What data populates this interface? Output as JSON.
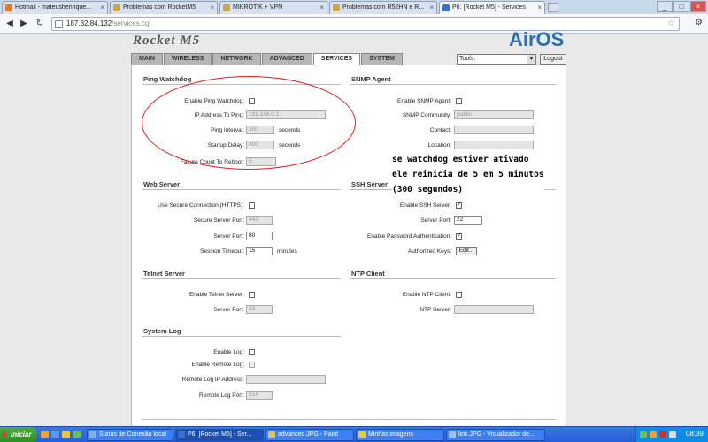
{
  "browser": {
    "tabs": [
      {
        "label": "Hotmail - mateushenrique...",
        "icon_color": "#e8762b",
        "active": false
      },
      {
        "label": "Problemas com RocketM5",
        "icon_color": "#c9a84d",
        "active": false
      },
      {
        "label": "MIKROTIK + VPN",
        "icon_color": "#c9a84d",
        "active": false
      },
      {
        "label": "Problemas com R52HN e R...",
        "icon_color": "#c9a84d",
        "active": false
      },
      {
        "label": "P6: [Rocket M5] - Services",
        "icon_color": "#3a74c9",
        "active": true
      }
    ],
    "close_glyph": "×",
    "url_host": "187.32.84.132",
    "url_path": "/services.cgi",
    "window_buttons": [
      "_",
      "□",
      "×"
    ]
  },
  "header": {
    "logo_text": "Rocket M5",
    "brand_text": "AirOS",
    "nav_tabs": [
      "MAIN",
      "WIRELESS",
      "NETWORK",
      "ADVANCED",
      "SERVICES",
      "SYSTEM"
    ],
    "active_tab": "SERVICES",
    "tools_label": "Tools:",
    "logout_label": "Logout"
  },
  "ping_watchdog": {
    "title": "Ping Watchdog",
    "enable_label": "Enable Ping Watchdog:",
    "ip_label": "IP Address To Ping:",
    "ip_value": "192.168.0.1",
    "interval_label": "Ping Interval:",
    "interval_value": "300",
    "interval_unit": "seconds",
    "delay_label": "Startup Delay:",
    "delay_value": "300",
    "delay_unit": "seconds",
    "failure_label": "Failure Count To Reboot:",
    "failure_value": "5"
  },
  "snmp_agent": {
    "title": "SNMP Agent",
    "enable_label": "Enable SNMP Agent:",
    "community_label": "SNMP Community:",
    "community_value": "public",
    "contact_label": "Contact:",
    "location_label": "Location:"
  },
  "web_server": {
    "title": "Web Server",
    "https_label": "Use Secure Connection (HTTPS):",
    "secure_port_label": "Secure Server Port:",
    "secure_port_value": "443",
    "port_label": "Server Port:",
    "port_value": "80",
    "timeout_label": "Session Timeout:",
    "timeout_value": "15",
    "timeout_unit": "minutes"
  },
  "ssh_server": {
    "title": "SSH Server",
    "enable_label": "Enable SSH Server:",
    "enable_checked": true,
    "port_label": "Server Port:",
    "port_value": "22",
    "password_label": "Enable Password Authentication:",
    "password_checked": true,
    "keys_label": "Authorized Keys:",
    "edit_label": "Edit..."
  },
  "telnet_server": {
    "title": "Telnet Server",
    "enable_label": "Enable Telnet Server:",
    "port_label": "Server Port:",
    "port_value": "23"
  },
  "ntp_client": {
    "title": "NTP Client",
    "enable_label": "Enable NTP Client:",
    "server_label": "NTP Server:"
  },
  "system_log": {
    "title": "System Log",
    "enable_label": "Enable Log:",
    "remote_label": "Enable Remote Log:",
    "remote_ip_label": "Remote Log IP Address:",
    "remote_port_label": "Remote Log Port:",
    "remote_port_value": "514"
  },
  "annotation": {
    "lines": [
      "se watchdog estiver ativado",
      "ele reinicia de 5 em 5 minutos",
      "(300 segundos)"
    ],
    "ellipse_color": "#e02020"
  },
  "taskbar": {
    "start_label": "Iniciar",
    "items": [
      {
        "label": "Status de Conexão local",
        "icon_color": "#7fb2e5"
      },
      {
        "label": "P6: [Rocket M5] - Ser...",
        "icon_color": "#3a74c9"
      },
      {
        "label": "advanced.JPG - Paint",
        "icon_color": "#d9c26a"
      },
      {
        "label": "Minhas imagens",
        "icon_color": "#e8c84a"
      },
      {
        "label": "link.JPG - Visualizador de...",
        "icon_color": "#9fc0e8"
      }
    ],
    "clock": "08:39"
  }
}
